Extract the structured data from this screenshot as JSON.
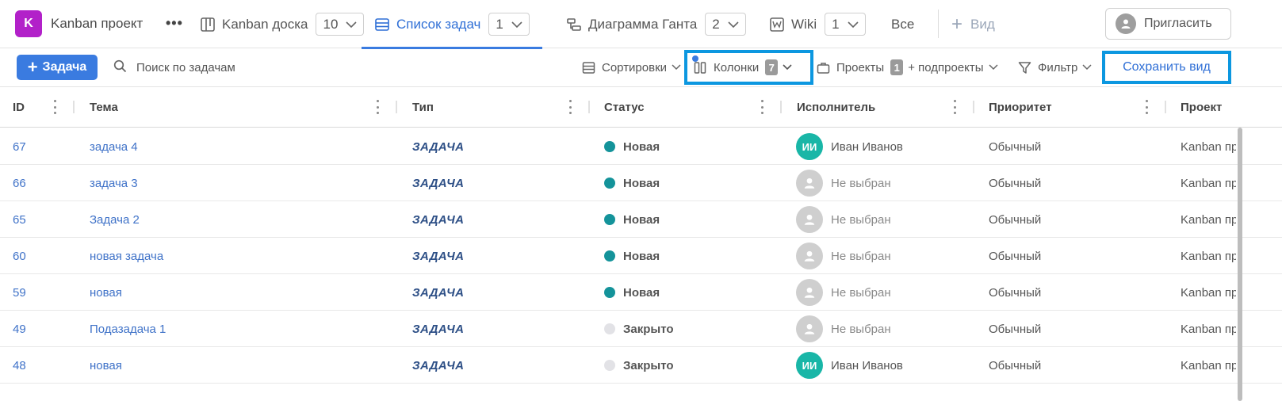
{
  "project": {
    "avatar_letter": "K",
    "name": "Kanban проект",
    "more": "•••",
    "avatar_color": "#b221c9"
  },
  "tabs": [
    {
      "label": "Kanban доска",
      "count": "10",
      "icon": "board-icon",
      "active": false
    },
    {
      "label": "Список задач",
      "count": "1",
      "icon": "list-icon",
      "active": true
    },
    {
      "label": "Диаграмма Ганта",
      "count": "2",
      "icon": "gantt-icon",
      "active": false
    },
    {
      "label": "Wiki",
      "count": "1",
      "icon": "wiki-icon",
      "active": false
    }
  ],
  "all_tab": "Все",
  "add_view": {
    "plus": "+",
    "label": "Вид"
  },
  "invite": {
    "label": "Пригласить"
  },
  "toolbar": {
    "add_task": "Задача",
    "search_placeholder": "Поиск по задачам",
    "sort": "Сортировки",
    "columns": "Колонки",
    "columns_count": "7",
    "projects": "Проекты",
    "projects_count": "1",
    "subprojects": "+ подпроекты",
    "filter": "Фильтр",
    "save_view": "Сохранить вид"
  },
  "columns": [
    "ID",
    "Тема",
    "Тип",
    "Статус",
    "Исполнитель",
    "Приоритет",
    "Проект"
  ],
  "rows": [
    {
      "id": "67",
      "title": "задача 4",
      "type": "ЗАДАЧА",
      "status": "Новая",
      "status_color": "#14939a",
      "assignee": "Иван Иванов",
      "initials": "ИИ",
      "priority": "Обычный",
      "project": "Kanban проект"
    },
    {
      "id": "66",
      "title": "задача 3",
      "type": "ЗАДАЧА",
      "status": "Новая",
      "status_color": "#14939a",
      "assignee": "Не выбран",
      "initials": "",
      "priority": "Обычный",
      "project": "Kanban проект"
    },
    {
      "id": "65",
      "title": "Задача 2",
      "type": "ЗАДАЧА",
      "status": "Новая",
      "status_color": "#14939a",
      "assignee": "Не выбран",
      "initials": "",
      "priority": "Обычный",
      "project": "Kanban проект"
    },
    {
      "id": "60",
      "title": "новая задача",
      "type": "ЗАДАЧА",
      "status": "Новая",
      "status_color": "#14939a",
      "assignee": "Не выбран",
      "initials": "",
      "priority": "Обычный",
      "project": "Kanban проект"
    },
    {
      "id": "59",
      "title": "новая",
      "type": "ЗАДАЧА",
      "status": "Новая",
      "status_color": "#14939a",
      "assignee": "Не выбран",
      "initials": "",
      "priority": "Обычный",
      "project": "Kanban проект"
    },
    {
      "id": "49",
      "title": "Подазадача 1",
      "type": "ЗАДАЧА",
      "status": "Закрыто",
      "status_color": "#e2e2e6",
      "assignee": "Не выбран",
      "initials": "",
      "priority": "Обычный",
      "project": "Kanban проект"
    },
    {
      "id": "48",
      "title": "новая",
      "type": "ЗАДАЧА",
      "status": "Закрыто",
      "status_color": "#e2e2e6",
      "assignee": "Иван Иванов",
      "initials": "ИИ",
      "priority": "Обычный",
      "project": "Kanban проект"
    }
  ],
  "colors": {
    "accent": "#3a7be0",
    "highlight": "#0c97e0",
    "avatar": "#19b6a7"
  }
}
